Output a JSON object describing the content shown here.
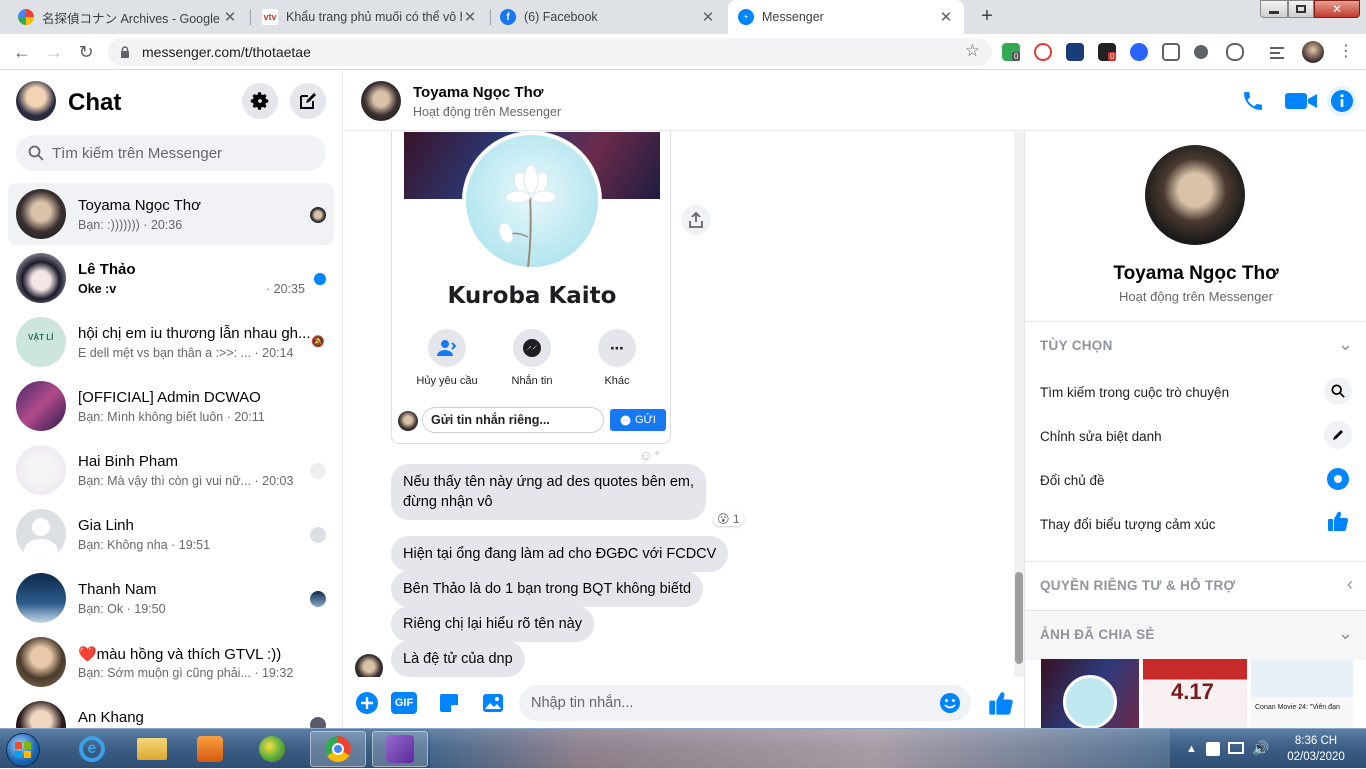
{
  "browser": {
    "tabs": [
      {
        "title": "名探偵コナン Archives - Google ...",
        "icon": "photos-icon"
      },
      {
        "title": "Khẩu trang phủ muối có thể vô h",
        "icon": "vtv-icon"
      },
      {
        "title": "(6) Facebook",
        "icon": "facebook-icon"
      },
      {
        "title": "Messenger",
        "icon": "messenger-icon"
      }
    ],
    "url": "messenger.com/t/thotaetae",
    "ext_badge_1": "0",
    "ext_badge_2": "0"
  },
  "sidebar": {
    "title": "Chat",
    "search_placeholder": "Tìm kiếm trên Messenger",
    "conversations": [
      {
        "name": "Toyama Ngọc Thơ",
        "snippet": "Bạn: :))))))) · 20:36",
        "selected": true
      },
      {
        "name": "Lê Thảo",
        "snippet": "Oke :v",
        "time": "· 20:35",
        "unread": true
      },
      {
        "name": "hội chị em iu thương lẫn nhau gh...",
        "snippet": "E dell mệt vs bạn thân a :>>: ... · 20:14"
      },
      {
        "name": "[OFFICIAL] Admin DCWAO",
        "snippet": "Bạn: Mình không biết luôn · 20:11"
      },
      {
        "name": "Hai Binh Pham",
        "snippet": "Bạn: Mà vậy thì còn gì vui nữ... · 20:03"
      },
      {
        "name": "Gia Linh",
        "snippet": "Bạn: Không nha · 19:51"
      },
      {
        "name": "Thanh Nam",
        "snippet": "Bạn: Ok · 19:50"
      },
      {
        "name": "❤️màu hồng và thích GTVL :))",
        "snippet": "Bạn: Sớm muộn gì cũng phải... · 19:32"
      },
      {
        "name": "An Khang",
        "snippet": ""
      }
    ]
  },
  "chat": {
    "name": "Toyama Ngọc Thơ",
    "status": "Hoạt động trên Messenger",
    "card": {
      "name": "Kuroba Kaito",
      "actions": [
        "Hủy yêu cầu",
        "Nhắn tin",
        "Khác"
      ],
      "input_placeholder": "Gửi tin nhắn riêng...",
      "send_label": "GỬI"
    },
    "messages": [
      {
        "text": "Nếu thấy tên này ứng ad des quotes bên em,\nđừng nhận vô",
        "reaction": "😮",
        "reaction_count": "1"
      },
      {
        "text": "Hiện tại ổng đang làm ad cho ĐGĐC với FCDCV"
      },
      {
        "text": "Bên Thảo là do 1 bạn trong BQT không biếtd"
      },
      {
        "text": "Riêng chị lại hiểu rõ tên này"
      },
      {
        "text": "Là đệ tử của dnp"
      }
    ],
    "composer_placeholder": "Nhập tin nhắn...",
    "gif_label": "GIF"
  },
  "info_panel": {
    "name": "Toyama Ngọc Thơ",
    "status": "Hoạt động trên Messenger",
    "options_header": "TÙY CHỌN",
    "options": [
      "Tìm kiếm trong cuộc trò chuyện",
      "Chỉnh sửa biệt danh",
      "Đổi chủ đề",
      "Thay đổi biểu tượng cảm xúc"
    ],
    "privacy_header": "QUYỀN RIÊNG TƯ & HỖ TRỢ",
    "shared_header": "ẢNH ĐÃ CHIA SẺ",
    "thumb_texts": [
      "4.17",
      "Conan Movie 24: \"Viên đạn"
    ]
  },
  "taskbar": {
    "time": "8:36 CH",
    "date": "02/03/2020"
  },
  "colors": {
    "accent": "#0084ff",
    "unread_dot": "#0084ff",
    "bubble": "#e4e6eb",
    "taskbar": "#3e5f86"
  }
}
